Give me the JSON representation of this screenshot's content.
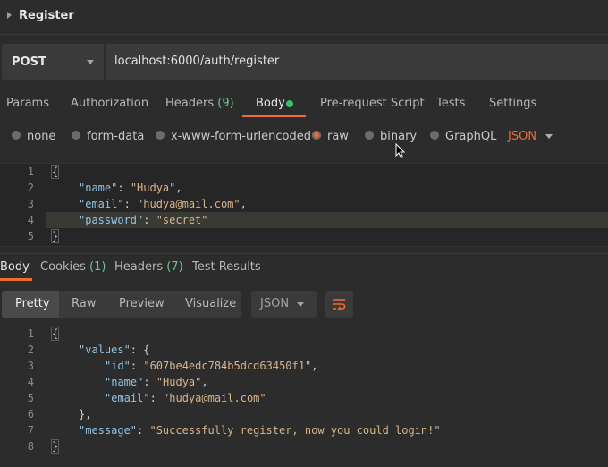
{
  "title": "Register",
  "request": {
    "method": "POST",
    "url": "localhost:6000/auth/register"
  },
  "tabs": {
    "params": "Params",
    "authorization": "Authorization",
    "headers": "Headers",
    "headers_count": "(9)",
    "body": "Body",
    "prerequest": "Pre-request Script",
    "tests": "Tests",
    "settings": "Settings"
  },
  "body_types": {
    "none": "none",
    "form_data": "form-data",
    "urlencoded": "x-www-form-urlencoded",
    "raw": "raw",
    "binary": "binary",
    "graphql": "GraphQL",
    "format": "JSON",
    "selected": "raw"
  },
  "request_body": {
    "line_numbers": [
      "1",
      "2",
      "3",
      "4",
      "5"
    ],
    "open_brace": "{",
    "close_brace": "}",
    "fields": [
      {
        "key": "\"name\"",
        "value": "\"Hudya\"",
        "sep": ": ",
        "end": ","
      },
      {
        "key": "\"email\"",
        "value": "\"hudya@mail.com\"",
        "sep": ": ",
        "end": ","
      },
      {
        "key": "\"password\"",
        "value": "\"secret\"",
        "sep": ": ",
        "end": ""
      }
    ]
  },
  "response_tabs": {
    "body": "Body",
    "cookies": "Cookies",
    "cookies_count": "(1)",
    "headers": "Headers",
    "headers_count": "(7)",
    "test_results": "Test Results"
  },
  "view_modes": {
    "pretty": "Pretty",
    "raw": "Raw",
    "preview": "Preview",
    "visualize": "Visualize",
    "format": "JSON"
  },
  "response_body": {
    "line_numbers": [
      "1",
      "2",
      "3",
      "4",
      "5",
      "6",
      "7",
      "8"
    ],
    "open_brace": "{",
    "close_brace": "}",
    "values_key": "\"values\"",
    "values_open": ": {",
    "values_close": "},",
    "id_key": "\"id\"",
    "id_value": "\"607be4edc784b5dcd63450f1\"",
    "name_key": "\"name\"",
    "name_value": "\"Hudya\"",
    "email_key": "\"email\"",
    "email_value": "\"hudya@mail.com\"",
    "message_key": "\"message\"",
    "message_value": "\"Successfully register, now you could login!\""
  },
  "colors": {
    "accent": "#ef6b2e",
    "success": "#3fbf6d",
    "json_key": "#8fc3e6",
    "json_string": "#d8b48a"
  }
}
